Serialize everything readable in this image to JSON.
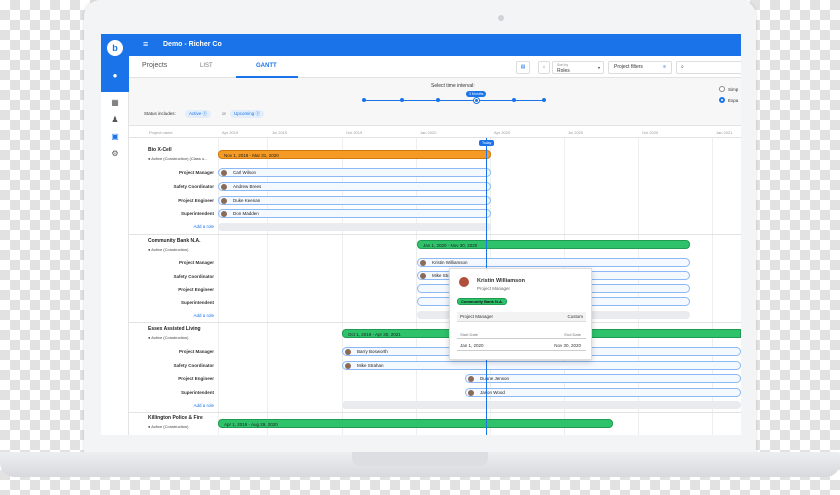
{
  "app": {
    "title": "Demo - Richer Co",
    "logo_letter": "b"
  },
  "tabs": {
    "projects": "Projects",
    "list": "LIST",
    "gantt": "GANTT"
  },
  "toolbar": {
    "sort_by_label": "Sort by",
    "sort_by_value": "Roles",
    "filters_label": "Project filters"
  },
  "interval": {
    "label": "Select time interval:",
    "value": "3 Months"
  },
  "view_options": {
    "simple": "Simp",
    "expanded": "Expa"
  },
  "status": {
    "label": "Status includes:",
    "chip1": "Active",
    "or": "or",
    "chip2": "Upcoming"
  },
  "columns": {
    "project_name": "Project name",
    "months": [
      "Apr 2019",
      "Jul 2019",
      "Oct 2019",
      "Jan 2020",
      "Apr 2020",
      "Jul 2020",
      "Oct 2020",
      "Jan 2021"
    ]
  },
  "today_label": "Today",
  "add_role": "Add a role",
  "projects": [
    {
      "name": "Bio X-Cell",
      "status": "● Active (Construction) (Class o...",
      "bar_label": "Nov 1, 2018 - Mar 31, 2020",
      "roles": [
        {
          "role": "Project Manager",
          "person": "Carl Wilson"
        },
        {
          "role": "Safety Coordinator",
          "person": "Andrew Brees"
        },
        {
          "role": "Project Engineer",
          "person": "Duke Keenan"
        },
        {
          "role": "Superintendent",
          "person": "Don Madden"
        }
      ]
    },
    {
      "name": "Community Bank N.A.",
      "status": "● Active (Construction)",
      "bar_label": "Jan 1, 2020 - Nov 30, 2020",
      "roles": [
        {
          "role": "Project Manager",
          "person": "Kristin Williamson"
        },
        {
          "role": "Safety Coordinator",
          "person": "Mike Strahan"
        },
        {
          "role": "Project Engineer",
          "person": ""
        },
        {
          "role": "Superintendent",
          "person": ""
        }
      ]
    },
    {
      "name": "Essex Assisted Living",
      "status": "● Active (Construction)",
      "bar_label": "Oct 1, 2019 - Apr 30, 2021",
      "roles": [
        {
          "role": "Project Manager",
          "person": "Barry Bosworth"
        },
        {
          "role": "Safety Coordinator",
          "person": "Mike Strahan"
        },
        {
          "role": "Project Engineer",
          "person": "Duane Jenson"
        },
        {
          "role": "Superintendent",
          "person": "Jason Wood"
        }
      ]
    },
    {
      "name": "Killington Police & Fire",
      "status": "● Active (Construction)",
      "bar_label": "Apr 1, 2019 - Aug 29, 2020",
      "roles": []
    }
  ],
  "popup": {
    "name": "Kristin Williamson",
    "role": "Project Manager",
    "project": "Community Bank N.A.",
    "field_role": "Project Manager",
    "field_custom": "Custom",
    "start_label": "Start Date",
    "end_label": "End Date",
    "start_value": "Jan 1, 2020",
    "end_value": "Nov 30, 2020"
  },
  "colors": {
    "brand": "#1a73e8",
    "orange": "#f49a25",
    "green": "#2ec26b"
  }
}
